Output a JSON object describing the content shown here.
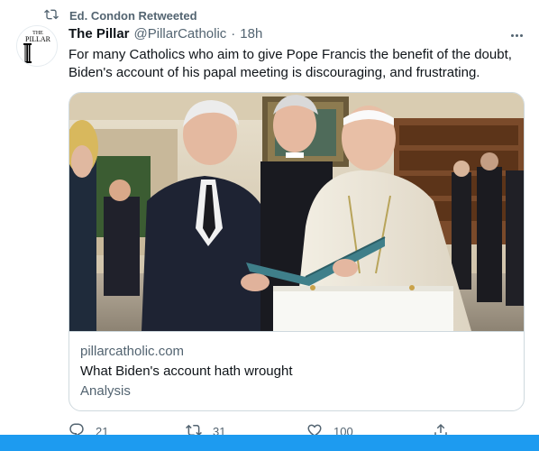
{
  "retweet": {
    "label": "Ed. Condon Retweeted"
  },
  "author": {
    "name": "The Pillar",
    "handle": "@PillarCatholic",
    "separator": "·",
    "time": "18h",
    "avatar_text_top": "THE",
    "avatar_text_main": "PILLAR"
  },
  "tweet": {
    "text": "For many Catholics who aim to give Pope Francis the benefit of the doubt, Biden's account of his papal meeting is discouraging, and frustrating."
  },
  "card": {
    "domain": "pillarcatholic.com",
    "title": "What Biden's account hath wrought",
    "description": "Analysis"
  },
  "actions": {
    "replies": "21",
    "retweets": "31",
    "likes": "100"
  },
  "colors": {
    "accent": "#1d9bf0",
    "secondary_text": "#536471",
    "primary_text": "#0f1419",
    "border": "#cfd9de"
  }
}
